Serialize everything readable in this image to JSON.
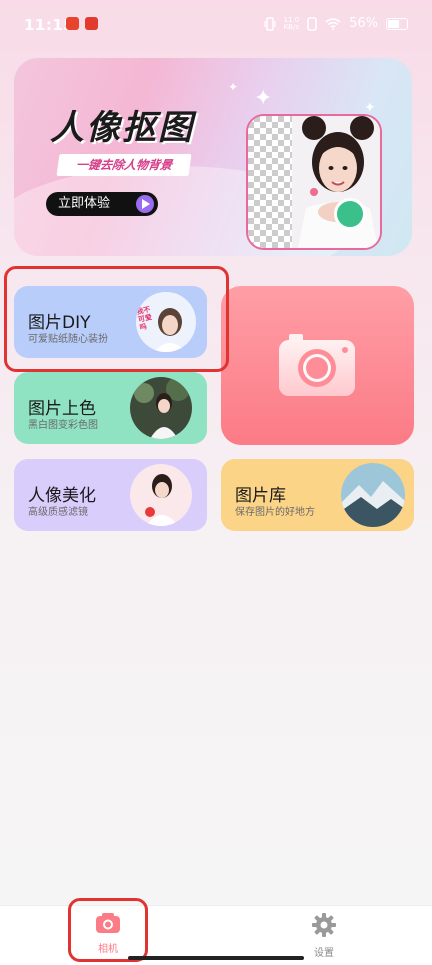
{
  "status_bar": {
    "time": "11:15",
    "net_speed_value": "11.0",
    "net_speed_unit": "KB/s",
    "battery": "56%"
  },
  "banner": {
    "title": "人像抠图",
    "subtitle": "一键去除人物背景",
    "cta": "立即体验"
  },
  "features": {
    "diy": {
      "title": "图片DIY",
      "desc": "可爱贴纸随心装扮",
      "thumb_text": "我不可爱吗"
    },
    "colorize": {
      "title": "图片上色",
      "desc": "黑白图变彩色图"
    },
    "beautify": {
      "title": "人像美化",
      "desc": "高级质感滤镜"
    },
    "gallery": {
      "title": "图片库",
      "desc": "保存图片的好地方"
    }
  },
  "tabbar": {
    "camera_label": "相机",
    "settings_label": "设置",
    "active": "camera"
  },
  "colors": {
    "accent_pink": "#fb7b86",
    "highlight_red": "#e23333",
    "diy_card": "#b9cdfb",
    "color_card": "#8fe3c3",
    "beauty_card": "#d8cdfb",
    "gallery_card": "#fcd487"
  },
  "icons": [
    "camera-icon",
    "gear-icon",
    "play-icon",
    "wifi-icon",
    "battery-icon",
    "vibrate-icon"
  ]
}
